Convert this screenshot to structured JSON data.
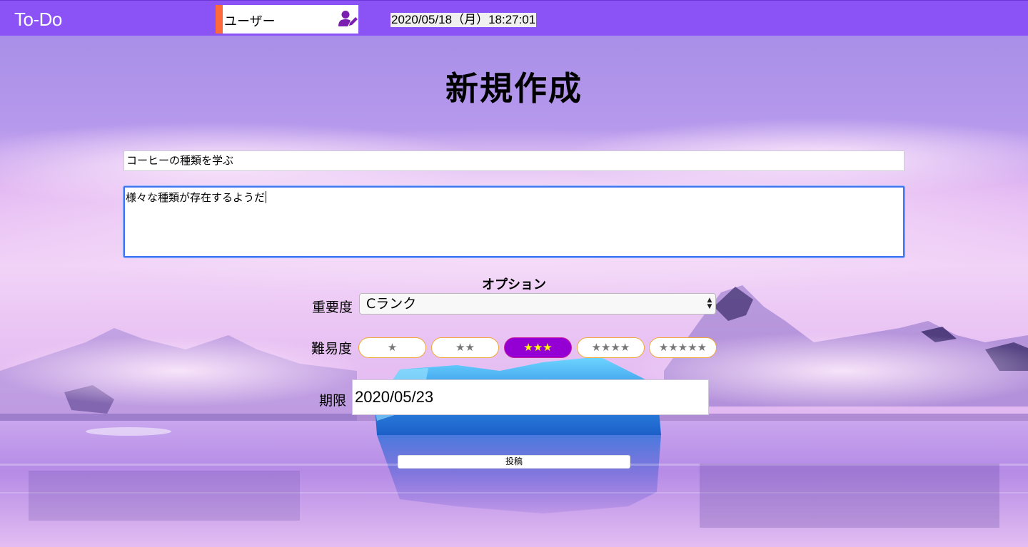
{
  "header": {
    "app_title": "To-Do",
    "user_name": "ユーザー",
    "user_icon": "user-edit-icon",
    "datetime": "2020/05/18（月）18:27:01"
  },
  "form": {
    "page_title": "新規作成",
    "title_value": "コーヒーの種類を学ぶ",
    "description_value": "様々な種類が存在するようだ",
    "options_heading": "オプション",
    "priority": {
      "label": "重要度",
      "selected": "Cランク"
    },
    "difficulty": {
      "label": "難易度",
      "selected_level": 3,
      "options": [
        "★",
        "★★",
        "★★★",
        "★★★★",
        "★★★★★"
      ]
    },
    "deadline": {
      "label": "期限",
      "value": "2020/05/23"
    },
    "submit_label": "投稿"
  },
  "colors": {
    "header_bg": "#8b53f5",
    "user_accent": "#ff6a3d",
    "active_star_bg": "#9400d3",
    "active_star_text": "#ffff00",
    "star_border": "#f0a93a"
  }
}
